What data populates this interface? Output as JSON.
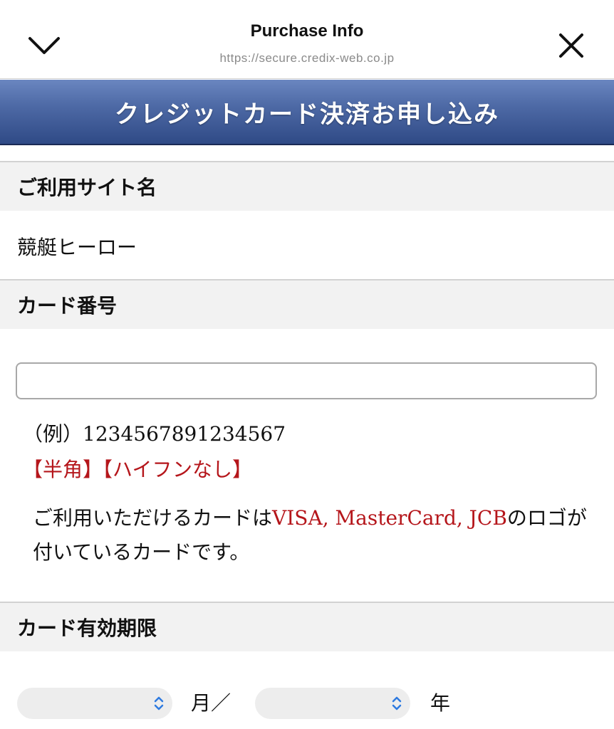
{
  "topbar": {
    "title": "Purchase Info",
    "url": "https://secure.credix-web.co.jp",
    "left_icon": "chevron-down-icon",
    "right_icon": "close-icon"
  },
  "banner": {
    "title": "クレジットカード決済お申し込み",
    "colors": {
      "top": "#6a86c0",
      "bottom": "#2f4a86"
    }
  },
  "site_section": {
    "heading": "ご利用サイト名",
    "value": "競艇ヒーロー"
  },
  "card_number_section": {
    "heading": "カード番号",
    "input_value": "",
    "example": "（例）1234567891234567",
    "note_halfwidth": "【半角】",
    "note_no_hyphen": "【ハイフンなし】",
    "notice_prefix": "ご利用いただけるカードは",
    "notice_brands": "VISA, MasterCard, JCB",
    "notice_suffix": "のロゴが付いているカードです。"
  },
  "expiry_section": {
    "heading": "カード有効期限",
    "month_select_value": "",
    "month_unit": "月／",
    "year_select_value": "",
    "year_unit": "年",
    "select_icon": "updown-chevron-icon"
  },
  "colors": {
    "accent_red": "#b5161b",
    "section_bg": "#f2f2f2",
    "url_gray": "#8a8a8a"
  }
}
